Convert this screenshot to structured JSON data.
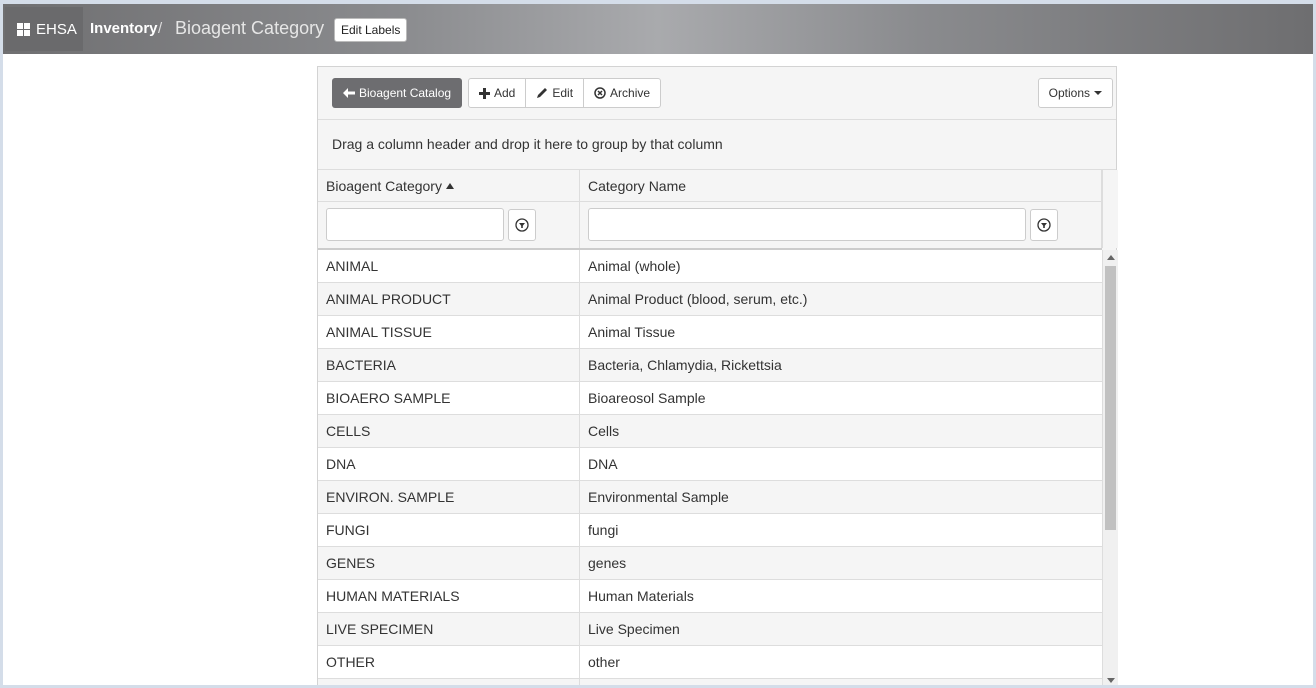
{
  "app": {
    "brand": "EHSA",
    "brand_icon": "grid-icon"
  },
  "breadcrumb": {
    "parent": "Inventory",
    "separator": "/",
    "current": "Bioagent Category"
  },
  "header": {
    "edit_labels": "Edit Labels"
  },
  "toolbar": {
    "back_label": "Bioagent Catalog",
    "add_label": "Add",
    "edit_label": "Edit",
    "archive_label": "Archive",
    "options_label": "Options"
  },
  "grid": {
    "group_hint": "Drag a column header and drop it here to group by that column",
    "columns": [
      {
        "label": "Bioagent Category",
        "sort": "ascending"
      },
      {
        "label": "Category Name"
      }
    ],
    "filters": [
      {
        "value": "",
        "placeholder": ""
      },
      {
        "value": "",
        "placeholder": ""
      }
    ],
    "rows": [
      {
        "category": "ANIMAL",
        "name": "Animal (whole)"
      },
      {
        "category": "ANIMAL PRODUCT",
        "name": "Animal Product (blood, serum, etc.)"
      },
      {
        "category": "ANIMAL TISSUE",
        "name": "Animal Tissue"
      },
      {
        "category": "BACTERIA",
        "name": "Bacteria, Chlamydia, Rickettsia"
      },
      {
        "category": "BIOAERO SAMPLE",
        "name": "Bioareosol Sample"
      },
      {
        "category": "CELLS",
        "name": "Cells"
      },
      {
        "category": "DNA",
        "name": "DNA"
      },
      {
        "category": "ENVIRON. SAMPLE",
        "name": "Environmental Sample"
      },
      {
        "category": "FUNGI",
        "name": "fungi"
      },
      {
        "category": "GENES",
        "name": "genes"
      },
      {
        "category": "HUMAN MATERIALS",
        "name": "Human Materials"
      },
      {
        "category": "LIVE SPECIMEN",
        "name": "Live Specimen"
      },
      {
        "category": "OTHER",
        "name": "other"
      },
      {
        "category": "",
        "name": ""
      }
    ]
  }
}
